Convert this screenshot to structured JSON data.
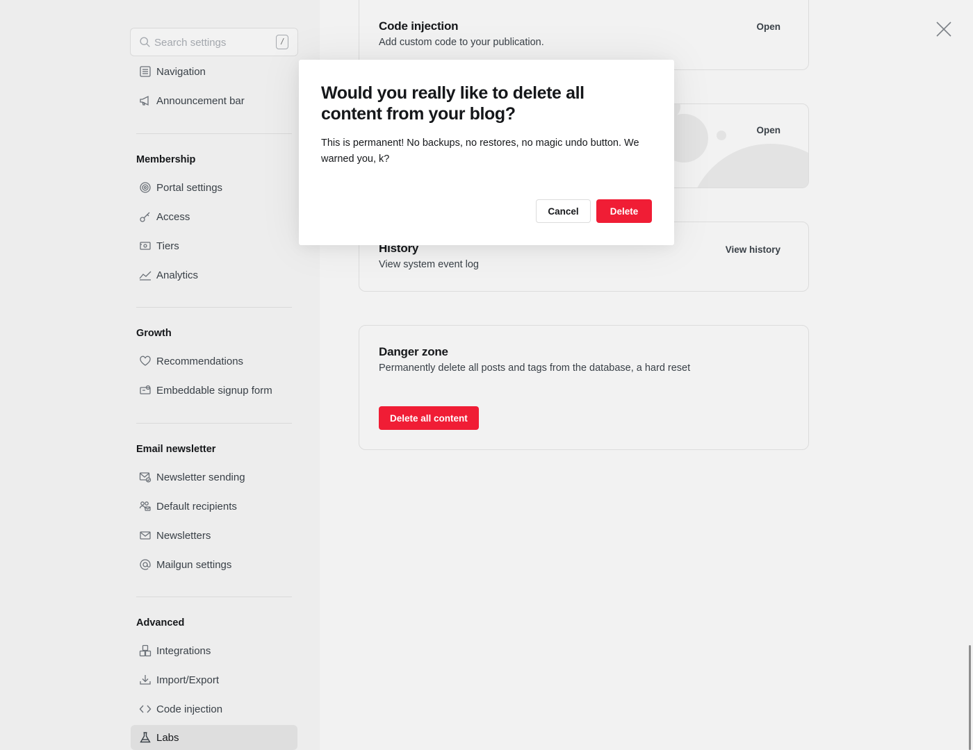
{
  "search": {
    "placeholder": "Search settings",
    "shortcut": "/"
  },
  "sidebar": {
    "top_items": [
      {
        "label": "Navigation",
        "icon": "navigation-icon"
      },
      {
        "label": "Announcement bar",
        "icon": "megaphone-icon"
      }
    ],
    "membership": {
      "title": "Membership",
      "items": [
        {
          "label": "Portal settings",
          "icon": "portal-icon"
        },
        {
          "label": "Access",
          "icon": "key-icon"
        },
        {
          "label": "Tiers",
          "icon": "tiers-icon"
        },
        {
          "label": "Analytics",
          "icon": "analytics-icon"
        }
      ]
    },
    "growth": {
      "title": "Growth",
      "items": [
        {
          "label": "Recommendations",
          "icon": "heart-icon"
        },
        {
          "label": "Embeddable signup form",
          "icon": "signup-form-icon"
        }
      ]
    },
    "email": {
      "title": "Email newsletter",
      "items": [
        {
          "label": "Newsletter sending",
          "icon": "mail-check-icon"
        },
        {
          "label": "Default recipients",
          "icon": "recipients-icon"
        },
        {
          "label": "Newsletters",
          "icon": "envelope-icon"
        },
        {
          "label": "Mailgun settings",
          "icon": "at-icon"
        }
      ]
    },
    "advanced": {
      "title": "Advanced",
      "items": [
        {
          "label": "Integrations",
          "icon": "integrations-icon"
        },
        {
          "label": "Import/Export",
          "icon": "download-icon"
        },
        {
          "label": "Code injection",
          "icon": "code-icon"
        },
        {
          "label": "Labs",
          "icon": "flask-icon",
          "active": true
        }
      ]
    }
  },
  "main": {
    "code_injection": {
      "title": "Code injection",
      "desc": "Add custom code to your publication.",
      "action": "Open"
    },
    "hidden_card": {
      "action": "Open"
    },
    "history": {
      "title": "History",
      "desc": "View system event log",
      "action": "View history"
    },
    "danger": {
      "title": "Danger zone",
      "desc": "Permanently delete all posts and tags from the database, a hard reset",
      "button": "Delete all content"
    }
  },
  "modal": {
    "title": "Would you really like to delete all content from your blog?",
    "body": "This is permanent! No backups, no restores, no magic undo button. We warned you, k?",
    "cancel": "Cancel",
    "confirm": "Delete"
  },
  "colors": {
    "accent_red": "#f01d35",
    "sidebar_bg": "#ededed",
    "content_bg": "#f2f2f2"
  }
}
